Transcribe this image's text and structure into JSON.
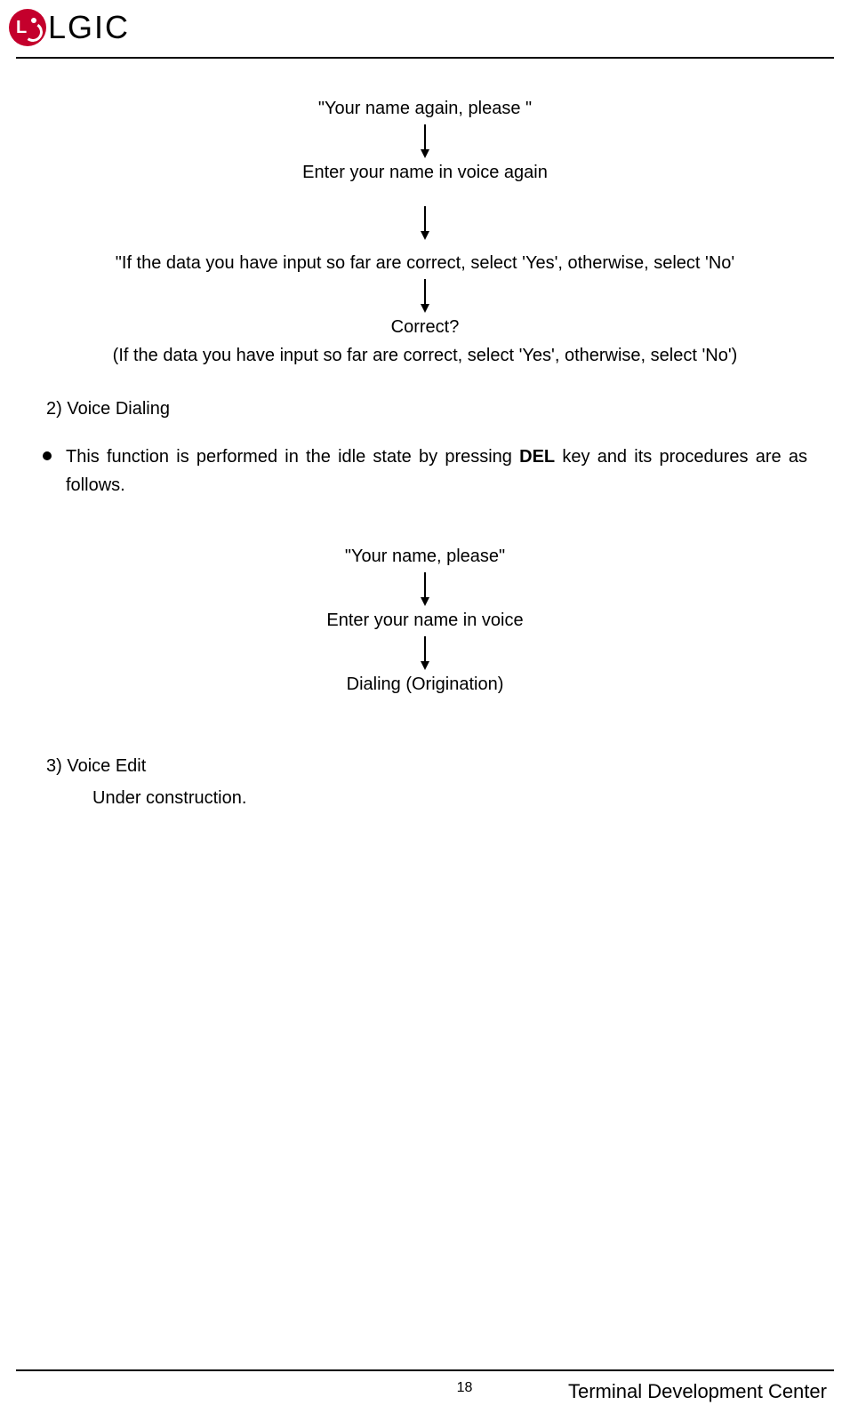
{
  "header": {
    "brand": "LGIC"
  },
  "flow1": {
    "step1": "\"Your name again, please \"",
    "step2": "Enter your name in voice again",
    "step3": "\"If the data you have input so far are correct, select 'Yes', otherwise, select 'No'",
    "step4": "Correct?",
    "step5": "(If the data you have input so far are correct, select 'Yes', otherwise, select 'No')"
  },
  "section2": {
    "title": "2) Voice Dialing",
    "bullet_part1": "This function is performed in the idle state by pressing ",
    "bullet_key": "DEL",
    "bullet_part2": " key and its procedures are as follows."
  },
  "flow2": {
    "step1": "\"Your name, please\"",
    "step2": "Enter your name in voice",
    "step3": "Dialing (Origination)"
  },
  "section3": {
    "title": "3) Voice Edit",
    "body": "Under construction."
  },
  "footer": {
    "page": "18",
    "org": "Terminal Development Center"
  }
}
